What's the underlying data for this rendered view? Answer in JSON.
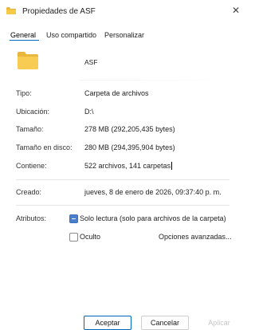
{
  "window": {
    "title": "Propiedades de ASF",
    "close_glyph": "✕"
  },
  "tabs": [
    {
      "label": "General",
      "active": true
    },
    {
      "label": "Uso compartido",
      "active": false
    },
    {
      "label": "Personalizar",
      "active": false
    }
  ],
  "folder": {
    "icon": "folder-icon",
    "name": "ASF"
  },
  "properties": {
    "tipo": {
      "label": "Tipo:",
      "value": "Carpeta de archivos"
    },
    "ubicacion": {
      "label": "Ubicación:",
      "value": "D:\\"
    },
    "tamano": {
      "label": "Tamaño:",
      "value": "278 MB (292,205,435 bytes)"
    },
    "tamano_disco": {
      "label": "Tamaño en disco:",
      "value": "280 MB (294,395,904 bytes)"
    },
    "contiene": {
      "label": "Contiene:",
      "value": "522 archivos, 141 carpetas"
    },
    "creado": {
      "label": "Creado:",
      "value": "jueves, 8 de enero de 2026, 09:37:40 p. m."
    }
  },
  "attributes": {
    "label": "Atributos:",
    "readonly": {
      "label": "Solo lectura (solo para archivos de la carpeta)",
      "state": "indeterminate"
    },
    "hidden": {
      "label": "Oculto",
      "state": "unchecked"
    },
    "advanced_button": "Opciones avanzadas..."
  },
  "buttons": {
    "accept": "Aceptar",
    "cancel": "Cancelar",
    "apply": "Aplicar"
  },
  "colors": {
    "accent": "#0067c0",
    "folder": "#f7c948"
  }
}
